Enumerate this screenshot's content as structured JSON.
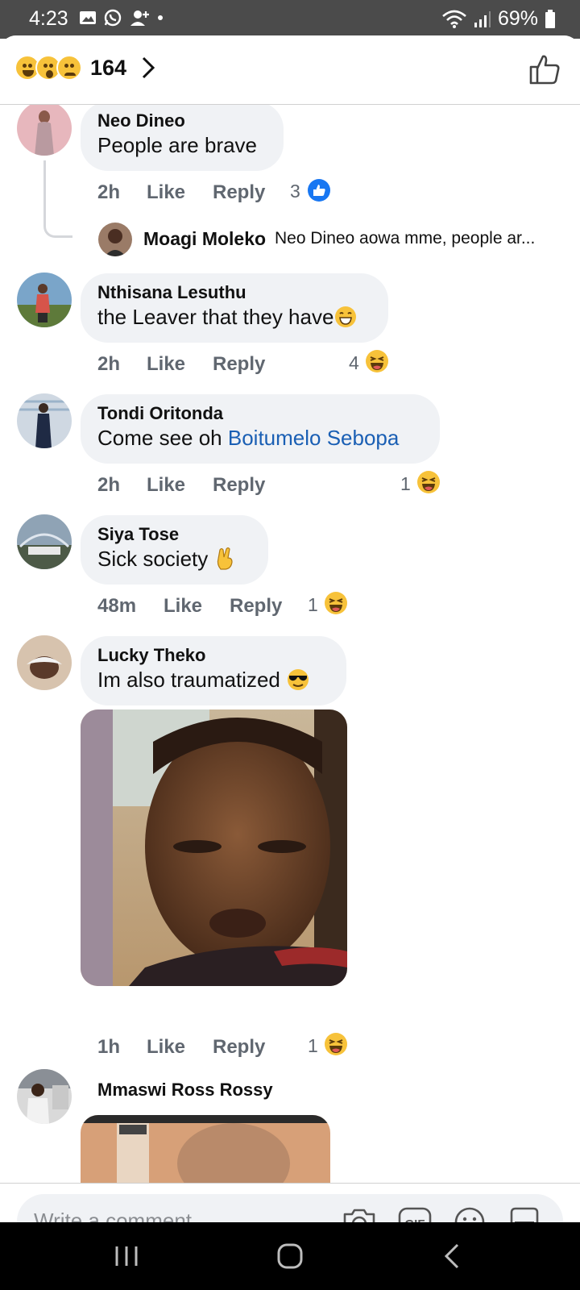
{
  "status_bar": {
    "time": "4:23",
    "battery": "69%"
  },
  "header": {
    "reaction_count": "164"
  },
  "comments": [
    {
      "name": "Neo Dineo",
      "text": "People are brave",
      "time": "2h",
      "like": "Like",
      "reply": "Reply",
      "reaction_count": "3",
      "reaction_type": "like"
    },
    {
      "name": "Nthisana Lesuthu",
      "text": "the Leaver that they have",
      "time": "2h",
      "like": "Like",
      "reply": "Reply",
      "reaction_count": "4",
      "reaction_type": "haha"
    },
    {
      "name": "Tondi Oritonda",
      "text": "Come see oh ",
      "mention": "Boitumelo Sebopa",
      "time": "2h",
      "like": "Like",
      "reply": "Reply",
      "reaction_count": "1",
      "reaction_type": "haha"
    },
    {
      "name": "Siya Tose",
      "text": "Sick society",
      "time": "48m",
      "like": "Like",
      "reply": "Reply",
      "reaction_count": "1",
      "reaction_type": "haha"
    },
    {
      "name": "Lucky Theko",
      "text": "Im also traumatized",
      "time": "1h",
      "like": "Like",
      "reply": "Reply",
      "reaction_count": "1",
      "reaction_type": "haha"
    },
    {
      "name": "Mmaswi Ross Rossy"
    }
  ],
  "reply_preview": {
    "name": "Moagi Moleko",
    "text": "Neo Dineo aowa mme, people ar..."
  },
  "composer": {
    "placeholder": "Write a comment..."
  },
  "colors": {
    "mention": "#1a5fb4",
    "like_blue": "#1877f2",
    "emoji_yellow": "#f7c23a"
  },
  "icons": [
    "camera-icon",
    "gif-icon",
    "emoji-icon",
    "sticker-icon",
    "thumbs-up-icon",
    "chevron-right-icon"
  ]
}
